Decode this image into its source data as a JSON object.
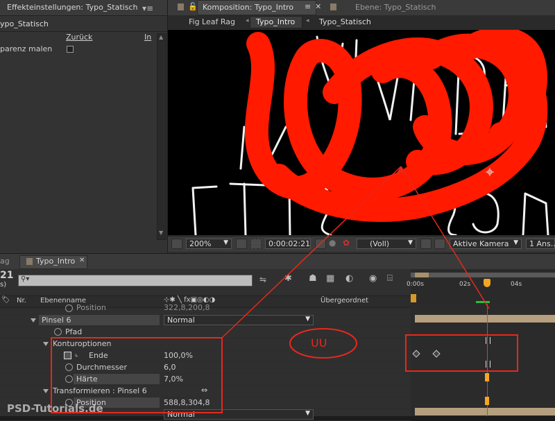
{
  "effects_panel": {
    "tab_title": "Effekteinstellungen: Typo_Statisch",
    "layer_name": "ypo_Statisch",
    "reset_label": "Zurück",
    "info_label": "In",
    "paint_label": "parenz malen"
  },
  "comp_panel": {
    "tab_title": "Komposition: Typo_Intro",
    "layer_tab_title": "Ebene: Typo_Statisch",
    "breadcrumbs": [
      "Fig Leaf Rag",
      "Typo_Intro",
      "Typo_Statisch"
    ],
    "zoom": "200%",
    "timecode": "0:00:02:21",
    "resolution": "(Voll)",
    "camera": "Aktive Kamera",
    "views": "1 Ans..."
  },
  "timeline": {
    "tab_left": "ag",
    "tab_title": "Typo_Intro",
    "timecode_partial": "21",
    "fps_partial": "s)",
    "col_nr": "Nr.",
    "col_layer": "Ebenenname",
    "col_parent": "Übergeordnet",
    "ruler": [
      "0:00s",
      "02s",
      "04s"
    ],
    "rows": {
      "position_top_label": "Position",
      "position_top_value": "322,8,200,8",
      "pinsel": "Pinsel 6",
      "pinsel_mode": "Normal",
      "pfad": "Pfad",
      "kontur": "Konturoptionen",
      "ende_label": "Ende",
      "ende_value": "100,0%",
      "durchmesser_label": "Durchmesser",
      "durchmesser_value": "6,0",
      "haerte_label": "Härte",
      "haerte_value": "7,0%",
      "transform_label": "Transformieren : Pinsel 6",
      "position_label": "Position",
      "position_value": "588,8,304,8",
      "bottom_mode": "Normal"
    }
  },
  "annotation": {
    "uu_label": "UU"
  },
  "watermark": "PSD-Tutorials.de",
  "colors": {
    "accent_orange": "#e3a42b",
    "annotation_red": "#e8281c",
    "paint_red": "#ff1a00",
    "bar_tan": "#b59f7e",
    "cti_orange": "#f5a623"
  }
}
